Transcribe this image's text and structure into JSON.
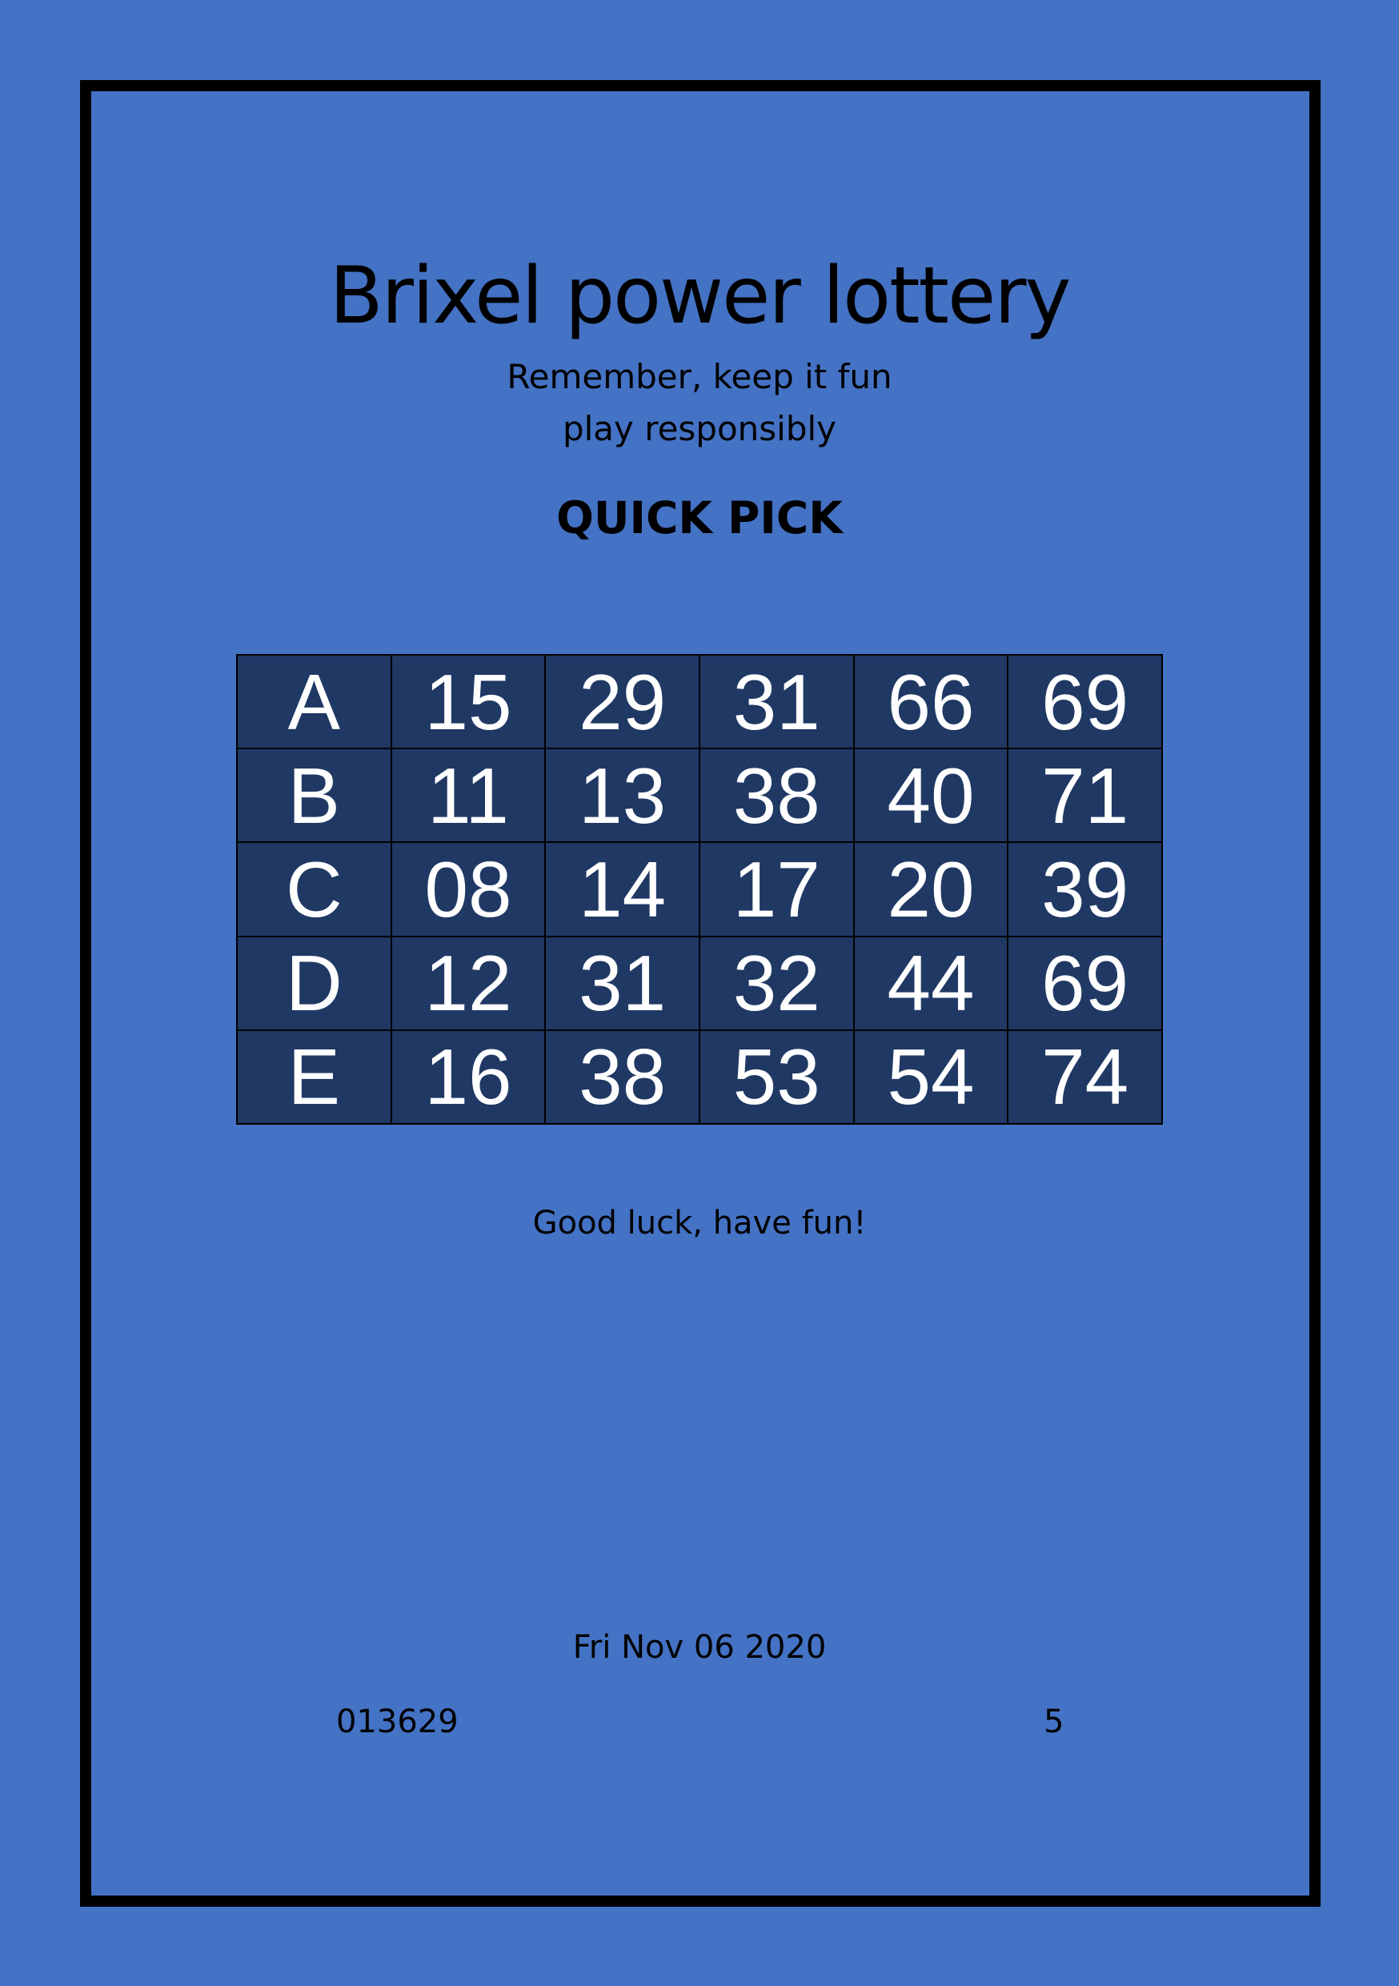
{
  "ticket": {
    "title": "Brixel power lottery",
    "subtitle_line1": "Remember, keep it fun",
    "subtitle_line2": "play responsibly",
    "mode": "QUICK PICK",
    "rows": [
      {
        "label": "A",
        "numbers": [
          "15",
          "29",
          "31",
          "66",
          "69"
        ]
      },
      {
        "label": "B",
        "numbers": [
          "11",
          "13",
          "38",
          "40",
          "71"
        ]
      },
      {
        "label": "C",
        "numbers": [
          "08",
          "14",
          "17",
          "20",
          "39"
        ]
      },
      {
        "label": "D",
        "numbers": [
          "12",
          "31",
          "32",
          "44",
          "69"
        ]
      },
      {
        "label": "E",
        "numbers": [
          "16",
          "38",
          "53",
          "54",
          "74"
        ]
      }
    ],
    "message": "Good luck, have fun!",
    "date": "Fri Nov 06 2020",
    "serial": "013629",
    "number": "5"
  },
  "colors": {
    "background": "#4472c4",
    "cell_fill": "#203864",
    "cell_text": "#ffffff",
    "border": "#000000"
  }
}
